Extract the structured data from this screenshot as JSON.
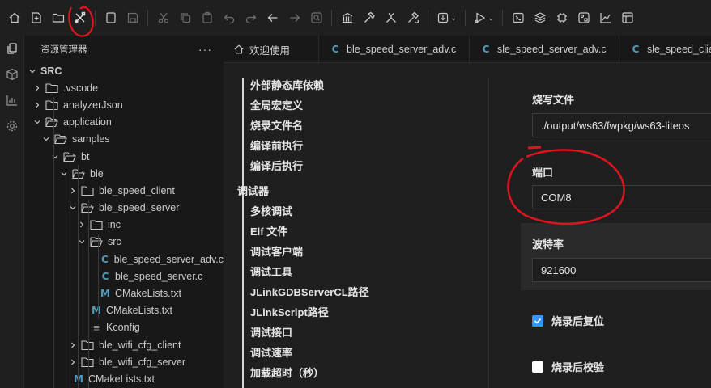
{
  "toolbar": {
    "icons": [
      "home-icon",
      "new-file-icon",
      "open-folder-icon",
      "tools-icon",
      "new-page-icon",
      "save-icon",
      "cut-icon",
      "copy-icon",
      "paste-icon",
      "undo-icon",
      "redo-icon",
      "back-icon",
      "forward-icon",
      "search-icon",
      "build-icon",
      "hammer-icon",
      "build-tools-icon",
      "rebuild-icon",
      "download-icon",
      "run-icon",
      "terminal-icon",
      "layers-icon",
      "chip-icon",
      "grid-icon",
      "chart-icon",
      "dashboard-icon"
    ]
  },
  "activity": {
    "icons": [
      "files-icon",
      "package-icon",
      "chart-icon",
      "settings-icon"
    ]
  },
  "explorer": {
    "title": "资源管理器",
    "more": "···",
    "root": "SRC",
    "items": [
      {
        "label": ".vscode",
        "kind": "folder"
      },
      {
        "label": "analyzerJson",
        "kind": "folder"
      },
      {
        "label": "application",
        "kind": "folder-open"
      },
      {
        "label": "samples",
        "kind": "folder-open"
      },
      {
        "label": "bt",
        "kind": "folder-open"
      },
      {
        "label": "ble",
        "kind": "folder-open"
      },
      {
        "label": "ble_speed_client",
        "kind": "folder"
      },
      {
        "label": "ble_speed_server",
        "kind": "folder-open"
      },
      {
        "label": "inc",
        "kind": "folder"
      },
      {
        "label": "src",
        "kind": "folder-open"
      },
      {
        "label": "ble_speed_server_adv.c",
        "kind": "c"
      },
      {
        "label": "ble_speed_server.c",
        "kind": "c"
      },
      {
        "label": "CMakeLists.txt",
        "kind": "m"
      },
      {
        "label": "CMakeLists.txt",
        "kind": "m"
      },
      {
        "label": "Kconfig",
        "kind": "k"
      },
      {
        "label": "ble_wifi_cfg_client",
        "kind": "folder"
      },
      {
        "label": "ble_wifi_cfg_server",
        "kind": "folder"
      },
      {
        "label": "CMakeLists.txt",
        "kind": "m"
      }
    ]
  },
  "tabs": [
    {
      "label": "欢迎使用",
      "icon": "home-icon"
    },
    {
      "label": "ble_speed_server_adv.c",
      "icon": "C"
    },
    {
      "label": "sle_speed_server_adv.c",
      "icon": "C"
    },
    {
      "label": "sle_speed_client",
      "icon": "C"
    }
  ],
  "outline": {
    "items_top": [
      "外部静态库依赖",
      "全局宏定义",
      "烧录文件名",
      "编译前执行",
      "编译后执行"
    ],
    "group": "调试器",
    "items_debug": [
      "多核调试",
      "Elf 文件",
      "调试客户端",
      "调试工具",
      "JLinkGDBServerCL路径",
      "JLinkScript路径",
      "调试接口",
      "调试速率",
      "加载超时（秒）"
    ]
  },
  "form": {
    "burn_file_label": "烧写文件",
    "burn_file_value": "./output/ws63/fwpkg/ws63-liteos",
    "port_label": "端口",
    "port_value": "COM8",
    "baud_label": "波特率",
    "baud_value": "921600",
    "reset_after_label": "烧录后复位",
    "reset_after_checked": true,
    "verify_after_label": "烧录后校验",
    "verify_after_checked": false
  },
  "colors": {
    "accent": "#3794ff",
    "annotation": "#e0141e",
    "c_icon": "#519aba"
  }
}
